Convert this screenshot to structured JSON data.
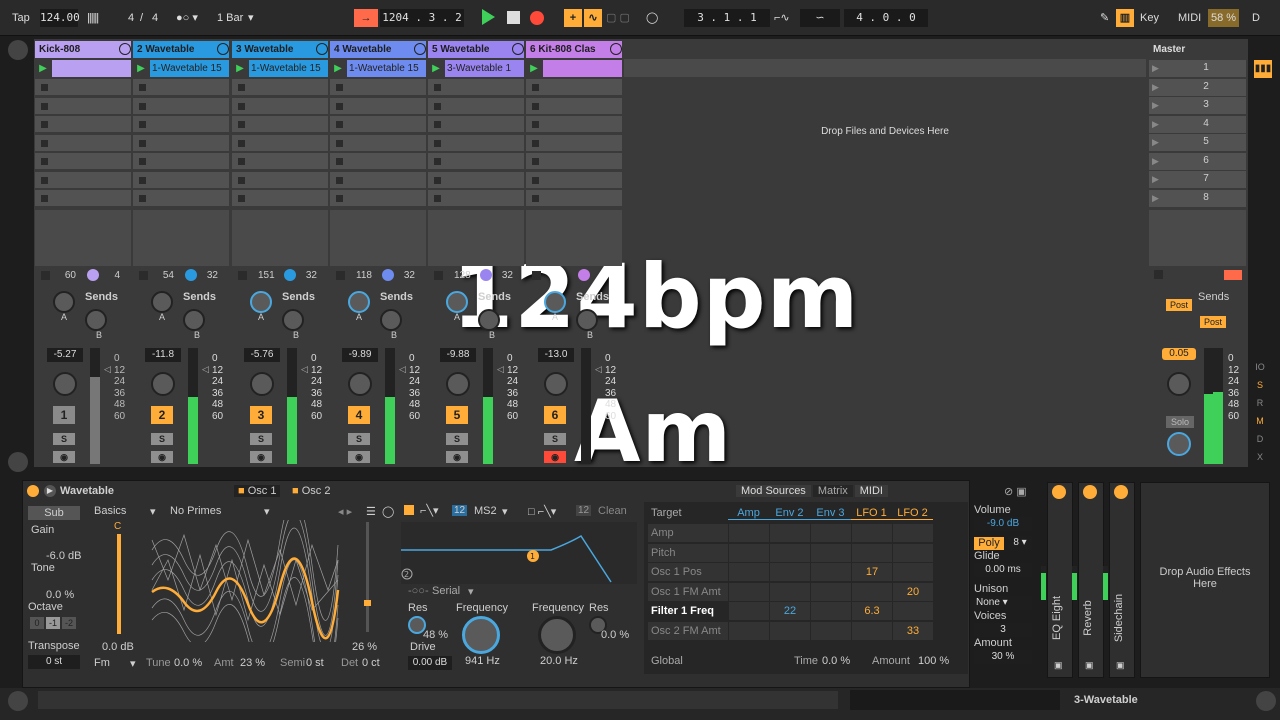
{
  "transport": {
    "tap": "Tap",
    "tempo": "124.00",
    "signature_num": "4",
    "signature_sep": "/",
    "signature_den": "4",
    "quantize": "1 Bar",
    "position": "1204 . 3 . 2",
    "loop_start": "3 . 1 . 1",
    "loop_length": "4 . 0 . 0",
    "key": "Key",
    "midi": "MIDI",
    "cpu": "58 %",
    "disk": "D"
  },
  "tracks": [
    {
      "name": "Kick-808",
      "color": "#b9a0f0",
      "clip": "",
      "vol": "-5.27",
      "send": "60",
      "pan": "4",
      "num": "1",
      "active": false
    },
    {
      "name": "2 Wavetable",
      "color": "#2a9ae0",
      "clip": "1-Wavetable 15",
      "vol": "-11.8",
      "send": "54",
      "pan": "32",
      "num": "2",
      "active": true
    },
    {
      "name": "3 Wavetable",
      "color": "#2a9ae0",
      "clip": "1-Wavetable 15",
      "vol": "-5.76",
      "send": "151",
      "pan": "32",
      "num": "3",
      "active": true
    },
    {
      "name": "4 Wavetable",
      "color": "#6e8cf0",
      "clip": "1-Wavetable 15",
      "vol": "-9.89",
      "send": "118",
      "pan": "32",
      "num": "4",
      "active": true
    },
    {
      "name": "5 Wavetable",
      "color": "#9a84f0",
      "clip": "3-Wavetable 1",
      "vol": "-9.88",
      "send": "128",
      "pan": "32",
      "num": "5",
      "active": true
    },
    {
      "name": "6 Kit-808 Clas",
      "color": "#c47ee8",
      "clip": "",
      "vol": "-13.0",
      "send": "",
      "pan": "",
      "num": "6",
      "active": true
    }
  ],
  "session": {
    "drop_text": "Drop Files and Devices Here",
    "sends_label": "Sends",
    "send_a": "A",
    "send_b": "B",
    "solo": "S"
  },
  "master": {
    "name": "Master",
    "scenes": [
      "1",
      "2",
      "3",
      "4",
      "5",
      "6",
      "7",
      "8"
    ],
    "post1": "Post",
    "post2": "Post",
    "vol": "0.05",
    "solo": "Solo"
  },
  "scale_marks": [
    "0",
    "12",
    "24",
    "36",
    "48",
    "60"
  ],
  "overlay": {
    "bpm": "124bpm",
    "key": "Am"
  },
  "device": {
    "title": "Wavetable",
    "osc1": "Osc 1",
    "osc2": "Osc 2",
    "sub": "Sub",
    "gain": "Gain",
    "gain_val": "-6.0 dB",
    "tone": "Tone",
    "tone_val": "0.0 %",
    "octave": "Octave",
    "oct_vals": [
      "0",
      "-1",
      "-2"
    ],
    "transpose": "Transpose",
    "transpose_val": "0 st",
    "category": "Basics",
    "wavetable": "No Primes",
    "osc_gain": "0.0 dB",
    "osc_pos": "26 %",
    "fm": "Fm",
    "tune": "Tune",
    "tune_val": "0.0 %",
    "amt": "Amt",
    "amt_val": "23 %",
    "semi": "Semi",
    "semi_val": "0 st",
    "det": "Det",
    "det_val": "0 ct",
    "filter_type": "MS2",
    "filter_slope": "12",
    "filter_circuit": "Clean",
    "routing": "Serial",
    "res": "Res",
    "res_val": "48 %",
    "drive": "Drive",
    "drive_val": "0.00 dB",
    "freq": "Frequency",
    "freq_val": "941 Hz",
    "freq2": "Frequency",
    "freq2_val": "20.0 Hz",
    "res2": "Res",
    "res2_val": "0.0 %"
  },
  "matrix": {
    "tabs": [
      "Mod Sources",
      "Matrix",
      "MIDI"
    ],
    "cols": [
      "Amp",
      "Env 2",
      "Env 3",
      "LFO 1",
      "LFO 2"
    ],
    "target": "Target",
    "rows": [
      {
        "name": "Amp",
        "vals": [
          "",
          "",
          "",
          "",
          ""
        ]
      },
      {
        "name": "Pitch",
        "vals": [
          "",
          "",
          "",
          "",
          ""
        ]
      },
      {
        "name": "Osc 1 Pos",
        "vals": [
          "",
          "",
          "",
          "17",
          ""
        ]
      },
      {
        "name": "Osc 1 FM Amt",
        "vals": [
          "",
          "",
          "",
          "",
          "20"
        ]
      },
      {
        "name": "Filter 1 Freq",
        "vals": [
          "",
          "22",
          "",
          "6.3",
          ""
        ]
      },
      {
        "name": "Osc 2 FM Amt",
        "vals": [
          "",
          "",
          "",
          "",
          "33"
        ]
      }
    ],
    "global": "Global",
    "time": "Time",
    "time_val": "0.0 %",
    "amount": "Amount",
    "amount_val": "100 %"
  },
  "voice": {
    "volume": "Volume",
    "volume_val": "-9.0 dB",
    "poly": "Poly",
    "poly_n": "8",
    "glide": "Glide",
    "glide_val": "0.00 ms",
    "unison": "Unison",
    "unison_val": "None",
    "voices": "Voices",
    "voices_val": "3",
    "amount": "Amount",
    "amount_val": "30 %"
  },
  "rack": {
    "fx": [
      "EQ Eight",
      "Reverb",
      "Sidechain"
    ],
    "drop": "Drop Audio Effects Here"
  },
  "status": {
    "clip_name": "3-Wavetable"
  }
}
